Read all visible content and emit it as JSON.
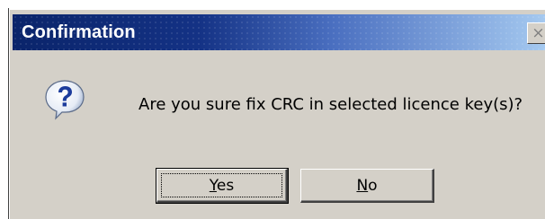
{
  "dialog": {
    "title": "Confirmation",
    "close_glyph": "×",
    "close_icon": "close-icon",
    "icon": "question-icon",
    "message": "Are you sure fix CRC in selected licence key(s)?",
    "buttons": {
      "yes": {
        "mnemonic": "Y",
        "rest": "es"
      },
      "no": {
        "mnemonic": "N",
        "rest": "o"
      }
    }
  },
  "colors": {
    "title_gradient_start": "#0a246a",
    "title_gradient_end": "#a6caf0",
    "dialog_face": "#d4d0c8",
    "icon_blue": "#1c3c9c"
  }
}
